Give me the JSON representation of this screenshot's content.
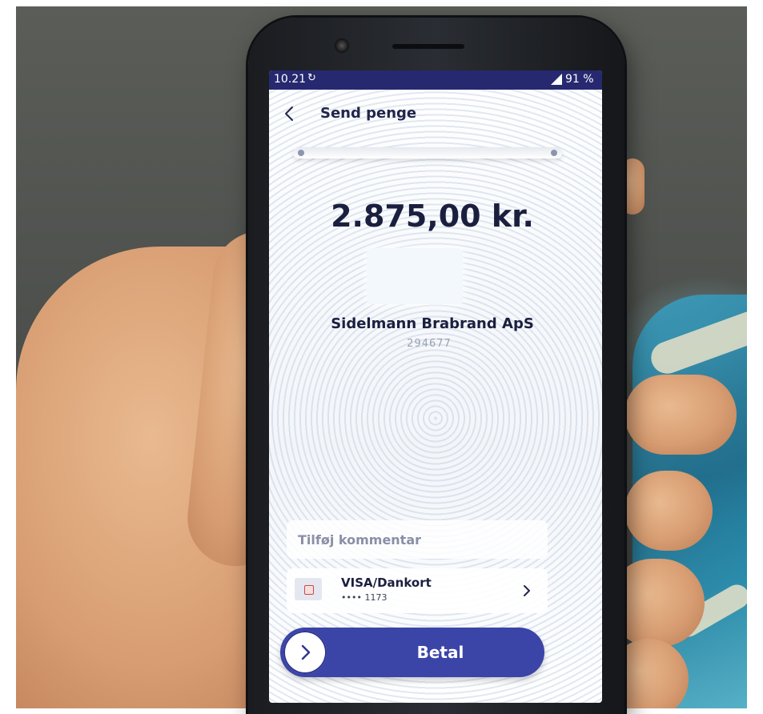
{
  "status_bar": {
    "time": "10.21",
    "sync_glyph": "↻",
    "battery": "91 %"
  },
  "header": {
    "title": "Send penge",
    "back_icon": "chevron-left-icon"
  },
  "payment": {
    "amount": "2.875,00 kr.",
    "merchant_name": "Sidelmann Brabrand ApS",
    "merchant_id": "294677"
  },
  "comment": {
    "placeholder": "Tilføj kommentar"
  },
  "card": {
    "name": "VISA/Dankort",
    "number": "•••• 1173",
    "icon": "card-icon"
  },
  "pay_button": {
    "label": "Betal",
    "icon": "chevron-right-icon"
  },
  "colors": {
    "status_bar": "#26296f",
    "accent": "#3b45a8",
    "text_dark": "#1b1f3f"
  }
}
